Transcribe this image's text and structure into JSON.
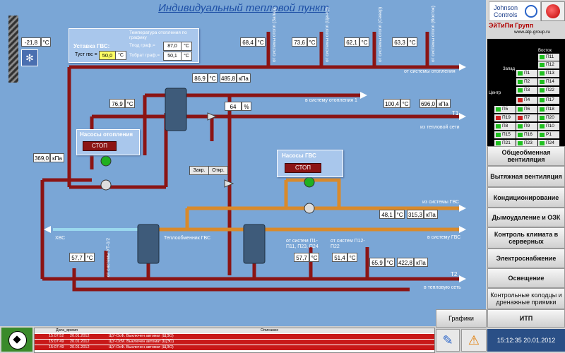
{
  "title": "Индивидуальный тепловой пункт",
  "brand": {
    "name_line1": "Johnson",
    "name_line2": "Controls",
    "company": "ЭйТиПи Групп",
    "url": "www.atp-group.ru"
  },
  "outdoor_temp": {
    "value": "-21,8",
    "unit": "°C"
  },
  "setpoint_panel": {
    "title": "Уставка ГВС:",
    "tust_label": "Туст гвс =",
    "tust_value": "50,0",
    "tust_unit": "°C",
    "graph_title": "Температура отопления по графику",
    "tpod_label": "Тпод граф.=",
    "tpod_value": "87,0",
    "tpod_unit": "°C",
    "tobr_label": "Тобрат граф.=",
    "tobr_value": "50,1",
    "tobr_unit": "°C"
  },
  "branches": [
    {
      "value": "68,4",
      "unit": "°C",
      "label": "от системы отопл (Запад)"
    },
    {
      "value": "73,6",
      "unit": "°C",
      "label": "от системы отопл (Центр)"
    },
    {
      "value": "62,1",
      "unit": "°C",
      "label": "от системы отопл (Север)"
    },
    {
      "value": "63,3",
      "unit": "°C",
      "label": "от системы отопл (Восток)"
    }
  ],
  "readings": {
    "hx_top_temp": {
      "value": "86,9",
      "unit": "°C"
    },
    "hx_top_press": {
      "value": "485,8",
      "unit": "кПа"
    },
    "supply_temp": {
      "value": "76,9",
      "unit": "°C"
    },
    "valve_pos": {
      "value": "64",
      "unit": "%"
    },
    "t1_temp": {
      "value": "100,4",
      "unit": "°C"
    },
    "t1_press": {
      "value": "696,0",
      "unit": "кПа"
    },
    "heat_press": {
      "value": "369,0",
      "unit": "кПа"
    },
    "gvs_temp": {
      "value": "48,1",
      "unit": "°C"
    },
    "gvs_press": {
      "value": "315,3",
      "unit": "кПа"
    },
    "left_temp": {
      "value": "57,7",
      "unit": "°C"
    },
    "mid_temp": {
      "value": "57,7",
      "unit": "°C"
    },
    "mid2_temp": {
      "value": "51,4",
      "unit": "°C"
    },
    "t2_temp": {
      "value": "65,9",
      "unit": "°C"
    },
    "t2_press": {
      "value": "422,8",
      "unit": "кПа"
    }
  },
  "labels": {
    "from_heating": "от системы отопления",
    "to_heating1": "в систему отопления 1",
    "t1": "T1",
    "from_heat_net": "из тепловой сети",
    "from_gvs": "из системы ГВС",
    "to_gvs": "в систему ГВС",
    "hvs": "ХВС",
    "hx_gvs": "Теплообменник ГВС",
    "from_p1": "от систем П1-П11, П23, П24",
    "from_p12": "от систем П12-П22",
    "t2": "T2",
    "to_heat_net": "в тепловую сеть",
    "from_ut": "от системы УТ-1/2",
    "close": "Закр.",
    "open": "Откр."
  },
  "pump_heating": {
    "title": "Насосы отопления",
    "state": "СТОП"
  },
  "pump_gvs": {
    "title": "Насосы ГВС",
    "state": "СТОП"
  },
  "zones": {
    "captions": {
      "east": "Восток",
      "west": "Запад",
      "center": "Центр"
    },
    "items": [
      {
        "name": "П11",
        "color": "#20c020"
      },
      {
        "name": "П1",
        "color": "#20c020"
      },
      {
        "name": "П12",
        "color": "#20c020"
      },
      {
        "name": "П2",
        "color": "#20c020"
      },
      {
        "name": "П13",
        "color": "#20c020"
      },
      {
        "name": "П3",
        "color": "#20c020"
      },
      {
        "name": "П14",
        "color": "#20c020"
      },
      {
        "name": "П4",
        "color": "#d02020"
      },
      {
        "name": "П17",
        "color": "#20c020"
      },
      {
        "name": "П5",
        "color": "#20c020"
      },
      {
        "name": "П18",
        "color": "#20c020"
      },
      {
        "name": "П6",
        "color": "#20c020"
      },
      {
        "name": "П19",
        "color": "#d02020"
      },
      {
        "name": "П7",
        "color": "#d02020"
      },
      {
        "name": "П20",
        "color": "#20c020"
      },
      {
        "name": "П8",
        "color": "#20c020"
      },
      {
        "name": "П9",
        "color": "#20c020"
      },
      {
        "name": "П10",
        "color": "#20c020"
      },
      {
        "name": "П15",
        "color": "#20c020"
      },
      {
        "name": "П16",
        "color": "#20c020"
      },
      {
        "name": "Р1",
        "color": "#20c020"
      },
      {
        "name": "П21",
        "color": "#20c020"
      },
      {
        "name": "П23",
        "color": "#20c020"
      },
      {
        "name": "П24",
        "color": "#20c020"
      },
      {
        "name": "П22",
        "color": "#20c020"
      }
    ]
  },
  "nav": [
    {
      "label": "Общеобменная вентиляция"
    },
    {
      "label": "Вытяжная вентиляция"
    },
    {
      "label": "Кондиционирование"
    },
    {
      "label": "Дымоудаление и ОЗК"
    },
    {
      "label": "Контроль климата в серверных"
    },
    {
      "label": "Электроснабжение"
    },
    {
      "label": "Освещение"
    },
    {
      "label": "Контрольные колодцы и дренажные приямки"
    },
    {
      "label": "ИТП"
    }
  ],
  "bottom": {
    "graphs_button": "Графики",
    "clock": "15:12:35 20.01.2012",
    "log_headers": {
      "datetime": "Дата_время",
      "desc": "Описание"
    },
    "log_rows": [
      {
        "time": "15:07:52",
        "date": "20.01.2012",
        "text": "ЩУ-ОсФ. Выключен автомат (ЩЭО)"
      },
      {
        "time": "15:07:49",
        "date": "20.01.2012",
        "text": "ЩУ-ОсМ. Выключен автомат (ЩЭО)"
      },
      {
        "time": "15:07:49",
        "date": "20.01.2012",
        "text": "ЩУ-ОсФ. Выключен автомат (ЩЭО)"
      }
    ]
  },
  "colors": {
    "pipe_hot": "#8b1414",
    "pipe_gvs": "#d98a2b",
    "pipe_cold": "#9ad8ee",
    "background": "#7aa6d6"
  }
}
